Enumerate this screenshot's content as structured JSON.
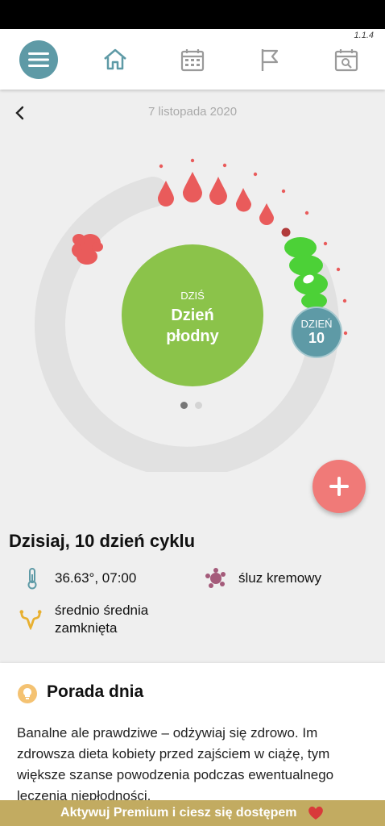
{
  "app": {
    "version": "1.1.4"
  },
  "nav": {
    "items": [
      "menu-icon",
      "home-icon",
      "calendar-icon",
      "flag-icon",
      "calendar-search-icon"
    ],
    "accent": "#5e9aa6",
    "inactive": "#9a9a9a"
  },
  "header": {
    "date": "7 listopada 2020"
  },
  "ring": {
    "center_small": "DZIŚ",
    "center_line1": "Dzień",
    "center_line2": "płodny",
    "badge_line1": "DZIEŃ",
    "badge_line2": "10",
    "center_color": "#8bc34a",
    "ring_color": "#e1e1e1",
    "period_color": "#e95b5b",
    "fertile_color": "#4cd137",
    "page_count": 2,
    "active_page": 1
  },
  "cycle": {
    "title": "Dzisiaj, 10 dzień cyklu",
    "temperature": "36.63°, 07:00",
    "mucus": "śluz kremowy",
    "cervix_line1": "średnio średnia",
    "cervix_line2": "zamknięta"
  },
  "tip": {
    "title": "Porada dnia",
    "body": "Banalne ale prawdziwe – odżywiaj się zdrowo. Im zdrowsza dieta kobiety przed zajściem w ciążę, tym większe szanse powodzenia podczas ewentualnego leczenia niepłodności."
  },
  "banner": {
    "text": "Aktywuj Premium i ciesz się dostępem",
    "color": "#c2ab61"
  }
}
